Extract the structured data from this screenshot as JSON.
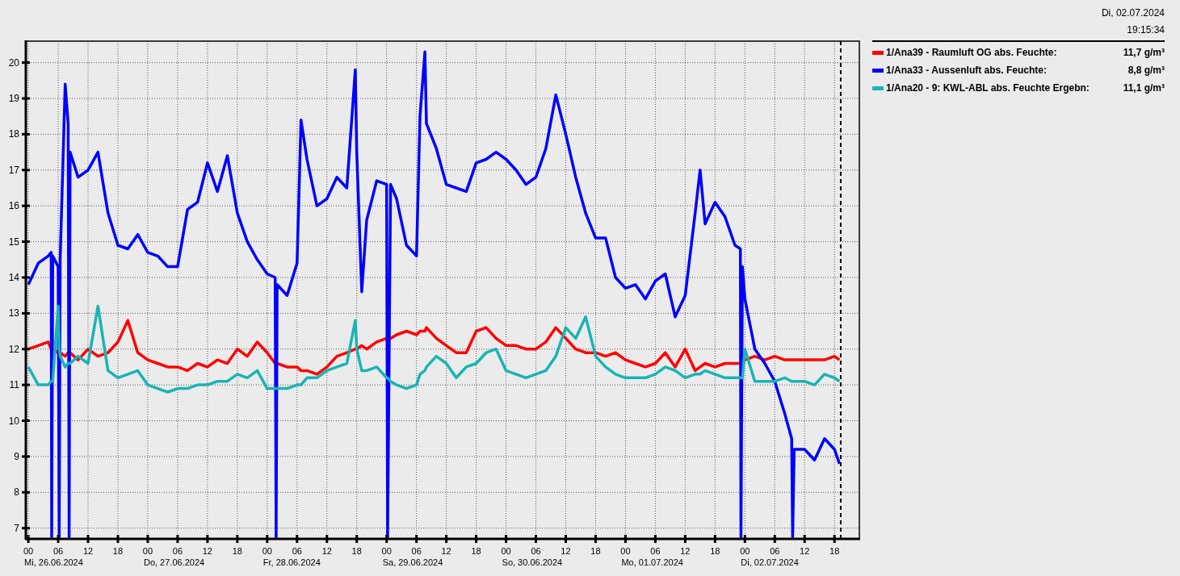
{
  "header": {
    "date": "Di, 02.07.2024",
    "time": "19:15:34"
  },
  "legend": [
    {
      "value": "11,7 g/m³"
    },
    {
      "value": "8,8 g/m³"
    },
    {
      "value": "11,1 g/m³"
    }
  ],
  "chart": {
    "day_labels": [
      "Mi, 26.06.2024",
      "Do, 27.06.2024",
      "Fr, 28.06.2024",
      "Sa, 29.06.2024",
      "So, 30.06.2024",
      "Mo, 01.07.2024",
      "Di, 02.07.2024"
    ],
    "chart_data": {
      "type": "line",
      "x": [
        0,
        2,
        4,
        4.6,
        4.7,
        4.9,
        6,
        6.2,
        6.4,
        7.4,
        8,
        8.2,
        8.4,
        10,
        12,
        14,
        16,
        18,
        20,
        22,
        24,
        26,
        28,
        30,
        32,
        34,
        36,
        38,
        40,
        42,
        44,
        46,
        48,
        49.6,
        49.8,
        50,
        52,
        54,
        54.8,
        56,
        58,
        60,
        62,
        64,
        65.7,
        66,
        67,
        68,
        70,
        72,
        72.2,
        72.8,
        74,
        76,
        78,
        78.7,
        79.7,
        80,
        82,
        84,
        86,
        88,
        90,
        92,
        94,
        96,
        98,
        100,
        102,
        104,
        106,
        108,
        110,
        112,
        114,
        116,
        118,
        120,
        122,
        124,
        126,
        128,
        130,
        132,
        134,
        135,
        136,
        138,
        140,
        142,
        143.1,
        143.2,
        143.5,
        144,
        146,
        148,
        150,
        152,
        153.4,
        153.6,
        153.9,
        154,
        156,
        158,
        160,
        162,
        163
      ],
      "series": [
        {
          "name": "1/Ana39 - Raumluft OG abs. Feuchte:",
          "color": "#ff0000",
          "values": [
            12.0,
            12.1,
            12.2,
            12.0,
            12.0,
            12.0,
            11.9,
            11.9,
            11.9,
            11.8,
            11.9,
            11.9,
            11.9,
            11.7,
            12.0,
            11.8,
            11.9,
            12.2,
            12.8,
            11.9,
            11.7,
            11.6,
            11.5,
            11.5,
            11.4,
            11.6,
            11.5,
            11.7,
            11.6,
            12.0,
            11.8,
            12.2,
            11.9,
            11.6,
            11.6,
            11.6,
            11.5,
            11.5,
            11.4,
            11.4,
            11.3,
            11.5,
            11.8,
            11.9,
            12.0,
            12.0,
            12.1,
            12.0,
            12.2,
            12.3,
            12.3,
            12.3,
            12.4,
            12.5,
            12.4,
            12.5,
            12.5,
            12.6,
            12.3,
            12.1,
            11.9,
            11.9,
            12.5,
            12.6,
            12.3,
            12.1,
            12.1,
            12.0,
            12.0,
            12.2,
            12.6,
            12.3,
            12.0,
            11.9,
            11.9,
            11.8,
            11.9,
            11.7,
            11.6,
            11.5,
            11.6,
            11.9,
            11.5,
            12.0,
            11.4,
            11.5,
            11.6,
            11.5,
            11.6,
            11.6,
            11.6,
            11.6,
            11.6,
            11.7,
            11.8,
            11.7,
            11.8,
            11.7,
            11.7,
            11.7,
            11.7,
            11.7,
            11.7,
            11.7,
            11.7,
            11.8,
            11.7
          ]
        },
        {
          "name": "1/Ana33 - Aussenluft abs. Feuchte:",
          "color": "#0000ff",
          "values": [
            13.8,
            14.4,
            14.6,
            14.7,
            6.75,
            14.6,
            14.3,
            6.75,
            14.5,
            19.4,
            18.3,
            6.75,
            17.5,
            16.8,
            17.0,
            17.5,
            15.8,
            14.9,
            14.8,
            15.2,
            14.7,
            14.6,
            14.3,
            14.3,
            15.9,
            16.1,
            17.2,
            16.4,
            17.4,
            15.8,
            15.0,
            14.5,
            14.1,
            14.0,
            6.75,
            13.8,
            13.5,
            14.4,
            18.4,
            17.3,
            16.0,
            16.2,
            16.8,
            16.5,
            19.8,
            17.5,
            13.6,
            15.6,
            16.7,
            16.6,
            6.75,
            16.6,
            16.2,
            14.9,
            14.6,
            18.5,
            20.3,
            18.3,
            17.6,
            16.6,
            16.5,
            16.4,
            17.2,
            17.3,
            17.5,
            17.3,
            17.0,
            16.6,
            16.8,
            17.6,
            19.1,
            18.0,
            16.8,
            15.8,
            15.1,
            15.1,
            14.0,
            13.7,
            13.8,
            13.4,
            13.9,
            14.1,
            12.9,
            13.5,
            15.8,
            17.0,
            15.5,
            16.1,
            15.7,
            14.9,
            14.8,
            6.75,
            14.3,
            13.4,
            12.0,
            11.6,
            11.1,
            10.2,
            9.5,
            6.75,
            9.2,
            9.2,
            9.2,
            8.9,
            9.5,
            9.2,
            8.8
          ]
        },
        {
          "name": "1/Ana20 - 9: KWL-ABL abs. Feuchte Ergebn:",
          "color": "#19b4b4",
          "values": [
            11.5,
            11.0,
            11.0,
            11.1,
            11.1,
            11.1,
            13.2,
            12.0,
            11.8,
            11.5,
            11.6,
            11.6,
            11.6,
            11.8,
            11.6,
            13.2,
            11.4,
            11.2,
            11.3,
            11.4,
            11.0,
            10.9,
            10.8,
            10.9,
            10.9,
            11.0,
            11.0,
            11.1,
            11.1,
            11.3,
            11.2,
            11.4,
            10.9,
            10.9,
            10.9,
            10.9,
            10.9,
            11.0,
            11.0,
            11.2,
            11.2,
            11.4,
            11.5,
            11.6,
            12.8,
            12.0,
            11.4,
            11.4,
            11.5,
            11.2,
            11.2,
            11.1,
            11.0,
            10.9,
            11.0,
            11.3,
            11.4,
            11.5,
            11.8,
            11.6,
            11.2,
            11.5,
            11.6,
            11.9,
            12.0,
            11.4,
            11.3,
            11.2,
            11.3,
            11.4,
            11.8,
            12.6,
            12.3,
            12.9,
            11.8,
            11.5,
            11.3,
            11.2,
            11.2,
            11.2,
            11.3,
            11.5,
            11.4,
            11.2,
            11.3,
            11.3,
            11.4,
            11.3,
            11.2,
            11.2,
            11.2,
            11.2,
            11.2,
            12.0,
            11.1,
            11.1,
            11.1,
            11.2,
            11.1,
            11.1,
            11.1,
            11.1,
            11.1,
            11.0,
            11.3,
            11.2,
            11.1
          ]
        }
      ],
      "xlim": [
        -0.5,
        167
      ],
      "ylim": [
        6.7,
        20.6
      ],
      "grid": true,
      "ref_lines": [
        {
          "axis": "x",
          "value": 163.26
        }
      ],
      "xticks": [
        {
          "value": 0,
          "label": "00"
        },
        {
          "value": 6,
          "label": "06"
        },
        {
          "value": 12,
          "label": "12"
        },
        {
          "value": 18,
          "label": "18"
        },
        {
          "value": 24,
          "label": "00"
        },
        {
          "value": 30,
          "label": "06"
        },
        {
          "value": 36,
          "label": "12"
        },
        {
          "value": 42,
          "label": "18"
        },
        {
          "value": 48,
          "label": "00"
        },
        {
          "value": 54,
          "label": "06"
        },
        {
          "value": 60,
          "label": "12"
        },
        {
          "value": 66,
          "label": "18"
        },
        {
          "value": 72,
          "label": "00"
        },
        {
          "value": 78,
          "label": "06"
        },
        {
          "value": 84,
          "label": "12"
        },
        {
          "value": 90,
          "label": "18"
        },
        {
          "value": 96,
          "label": "00"
        },
        {
          "value": 102,
          "label": "06"
        },
        {
          "value": 108,
          "label": "12"
        },
        {
          "value": 114,
          "label": "18"
        },
        {
          "value": 120,
          "label": "00"
        },
        {
          "value": 126,
          "label": "06"
        },
        {
          "value": 132,
          "label": "12"
        },
        {
          "value": 138,
          "label": "18"
        },
        {
          "value": 144,
          "label": "00"
        },
        {
          "value": 150,
          "label": "06"
        },
        {
          "value": 156,
          "label": "12"
        },
        {
          "value": 162,
          "label": "18"
        }
      ],
      "yticks": [
        7,
        8,
        9,
        10,
        11,
        12,
        13,
        14,
        15,
        16,
        17,
        18,
        19,
        20
      ]
    }
  }
}
